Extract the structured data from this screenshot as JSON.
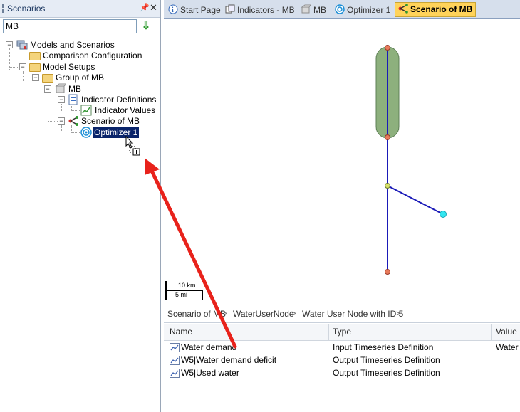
{
  "scenarios_panel": {
    "title": "Scenarios",
    "pin_glyph": "p",
    "search_value": "MB",
    "tree": [
      {
        "label": "Models and Scenarios",
        "icon": "models-scenarios-icon"
      },
      {
        "label": "Comparison Configuration",
        "icon": "folder-icon"
      },
      {
        "label": "Model Setups",
        "icon": "folder-icon"
      },
      {
        "label": "Group of MB",
        "icon": "folder-icon"
      },
      {
        "label": "MB",
        "icon": "model-icon"
      },
      {
        "label": "Indicator Definitions",
        "icon": "indicator-definitions-icon"
      },
      {
        "label": "Indicator Values",
        "icon": "indicator-values-icon"
      },
      {
        "label": "Scenario of MB",
        "icon": "scenario-icon"
      },
      {
        "label": "Optimizer 1",
        "icon": "optimizer-icon"
      }
    ]
  },
  "tabs": [
    {
      "label": "Start Page",
      "icon": "start-page-icon"
    },
    {
      "label": "Indicators - MB",
      "icon": "indicators-icon"
    },
    {
      "label": "MB",
      "icon": "model-icon"
    },
    {
      "label": "Optimizer 1",
      "icon": "optimizer-icon"
    },
    {
      "label": "Scenario of MB",
      "icon": "scenario-icon",
      "active": true
    }
  ],
  "map": {
    "scale_km": "10 km",
    "scale_mi": "5 mi",
    "colors": {
      "network_line": "#1a1ab8",
      "reservoir": "#8db07d",
      "node": "#e87a5a",
      "junction": "#d6e06a",
      "user_node": "#33e6f0"
    }
  },
  "breadcrumb": [
    "Scenario of MB",
    "WaterUserNode",
    "Water User Node with ID 5"
  ],
  "grid": {
    "columns": [
      "Name",
      "Type",
      "Value"
    ],
    "rows": [
      {
        "name": "Water demand",
        "type": "Input Timeseries Definition",
        "value": "Water"
      },
      {
        "name": "W5|Water demand deficit",
        "type": "Output Timeseries Definition",
        "value": ""
      },
      {
        "name": "W5|Used water",
        "type": "Output Timeseries Definition",
        "value": ""
      }
    ]
  },
  "annotation": {
    "arrow_color": "#e8221b"
  }
}
